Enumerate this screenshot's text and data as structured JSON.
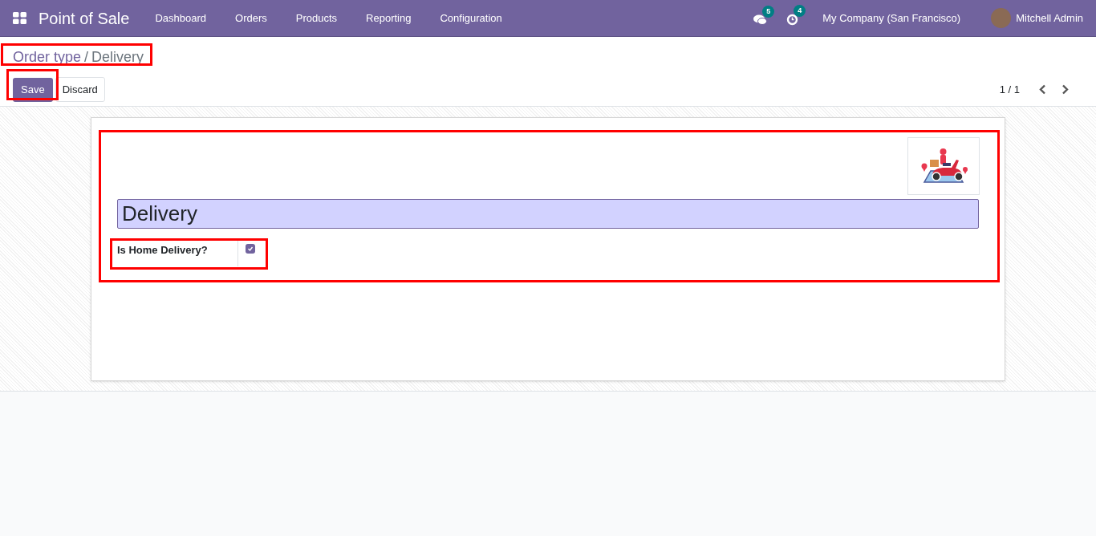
{
  "navbar": {
    "app_name": "Point of Sale",
    "menu": [
      "Dashboard",
      "Orders",
      "Products",
      "Reporting",
      "Configuration"
    ],
    "messages_count": "5",
    "activities_count": "4",
    "company": "My Company (San Francisco)",
    "user": "Mitchell Admin"
  },
  "breadcrumb": {
    "parent": "Order type",
    "separator": "/",
    "current": "Delivery"
  },
  "buttons": {
    "save": "Save",
    "discard": "Discard"
  },
  "pager": {
    "text": "1 / 1"
  },
  "form": {
    "name": "Delivery",
    "fields": [
      {
        "label": "Is Home Delivery?",
        "kind": "checkbox",
        "checked": true
      }
    ]
  }
}
